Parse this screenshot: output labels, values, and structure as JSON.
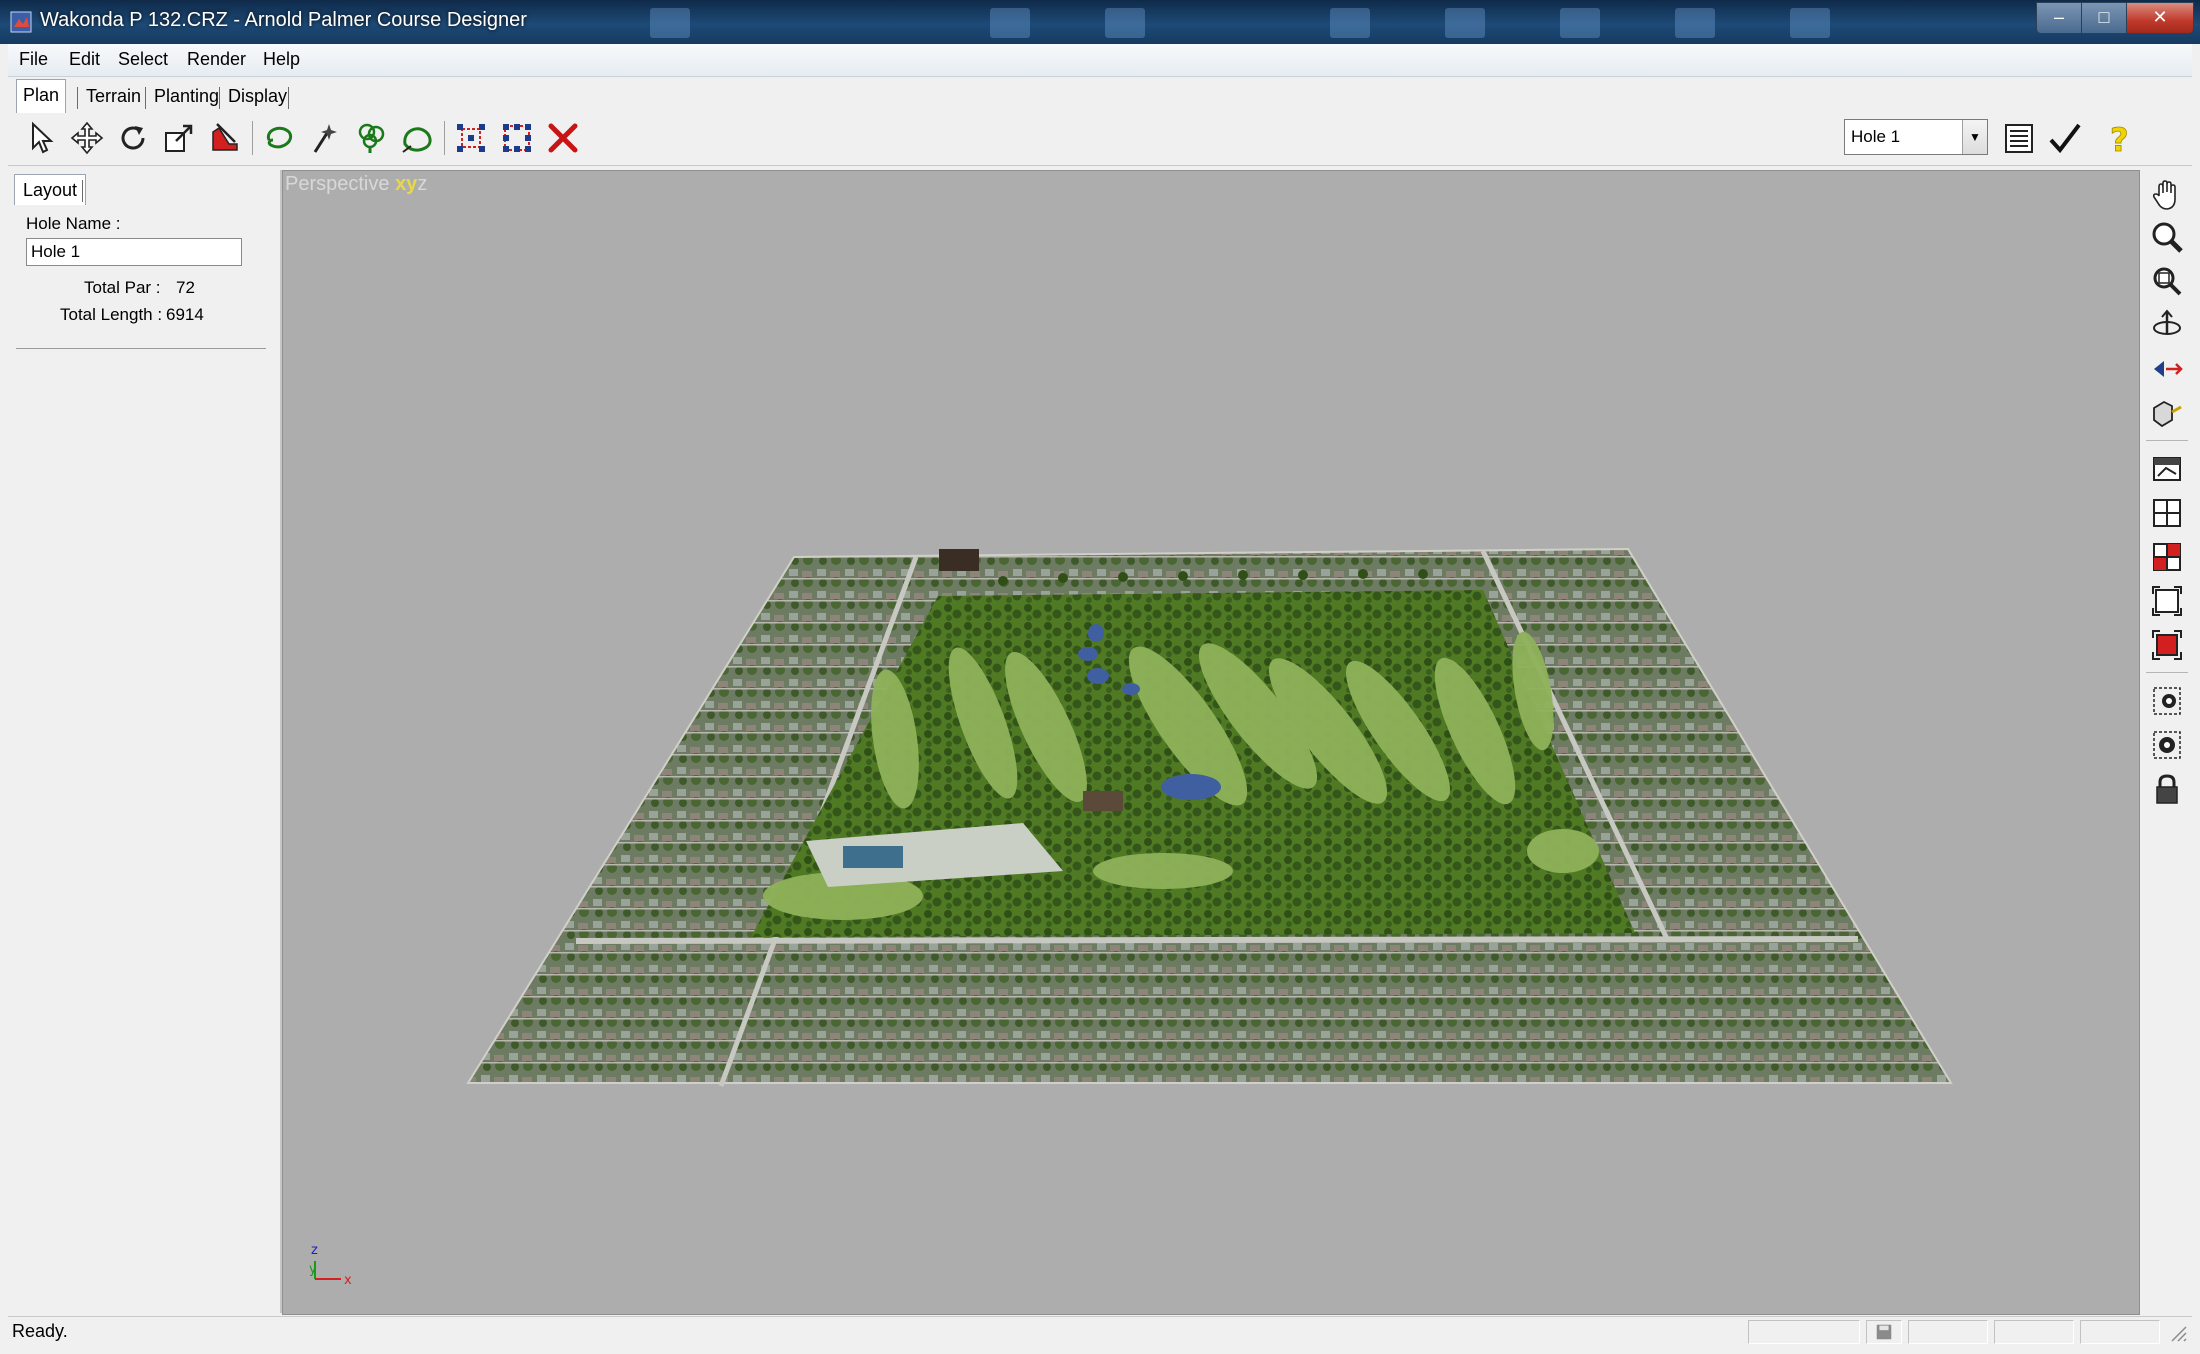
{
  "window": {
    "title": "Wakonda P 132.CRZ - Arnold Palmer Course Designer",
    "controls": {
      "minimize": "–",
      "maximize": "□",
      "close": "✕"
    }
  },
  "menu": [
    {
      "label": "File"
    },
    {
      "label": "Edit"
    },
    {
      "label": "Select"
    },
    {
      "label": "Render"
    },
    {
      "label": "Help"
    }
  ],
  "tabs": [
    {
      "label": "Plan",
      "active": true
    },
    {
      "label": "Terrain"
    },
    {
      "label": "Planting"
    },
    {
      "label": "Display"
    }
  ],
  "toolbar": {
    "tools": [
      "select-arrow-icon",
      "move-icon",
      "rotate-icon",
      "scale-icon",
      "erase-icon",
      "lasso-icon",
      "wand-icon",
      "tree-icon",
      "freeform-icon",
      "select-all-icon",
      "select-grid-icon",
      "delete-icon"
    ],
    "hole_selector": {
      "value": "Hole 1"
    },
    "right_tools": [
      "notes-icon",
      "checkmark-icon",
      "help-icon"
    ]
  },
  "left_panel": {
    "tab": "Layout",
    "hole_name_label": "Hole Name :",
    "hole_name_value": "Hole 1",
    "total_par_label": "Total Par :",
    "total_par_value": "72",
    "total_length_label": "Total Length :",
    "total_length_value": "6914"
  },
  "viewport": {
    "label": "Perspective",
    "axes_xy": "xy",
    "axes_z": "z",
    "gizmo": {
      "z": "z",
      "y": "y",
      "x": "x"
    },
    "colors": {
      "background": "#adadad",
      "grass": "#4f7a23",
      "fairway": "#8fb25a",
      "water": "#3f5fa0"
    }
  },
  "right_tools": [
    "pan-hand-icon",
    "zoom-icon",
    "zoom-extents-icon",
    "orbit-icon",
    "walk-icon",
    "camera-icon",
    "view-3d-icon",
    "view-quad-icon",
    "view-red-icon",
    "frame-icon",
    "frame-red-icon",
    "target-icon",
    "target-dots-icon",
    "lock-icon"
  ],
  "status": {
    "text": "Ready."
  }
}
